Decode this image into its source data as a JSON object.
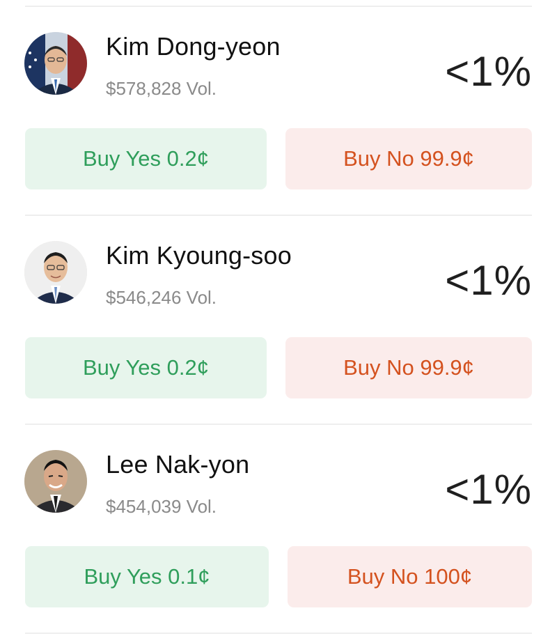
{
  "candidates": [
    {
      "name": "Kim Dong-yeon",
      "volume": "$578,828 Vol.",
      "probability": "<1%",
      "buy_yes_label": "Buy Yes 0.2¢",
      "buy_no_label": "Buy No 99.9¢"
    },
    {
      "name": "Kim Kyoung-soo",
      "volume": "$546,246 Vol.",
      "probability": "<1%",
      "buy_yes_label": "Buy Yes 0.2¢",
      "buy_no_label": "Buy No 99.9¢"
    },
    {
      "name": "Lee Nak-yon",
      "volume": "$454,039 Vol.",
      "probability": "<1%",
      "buy_yes_label": "Buy Yes 0.1¢",
      "buy_no_label": "Buy No 100¢"
    }
  ],
  "colors": {
    "yes_text": "#2f9e5b",
    "yes_bg": "#e7f5ec",
    "no_text": "#d4521f",
    "no_bg": "#fbeceb"
  }
}
